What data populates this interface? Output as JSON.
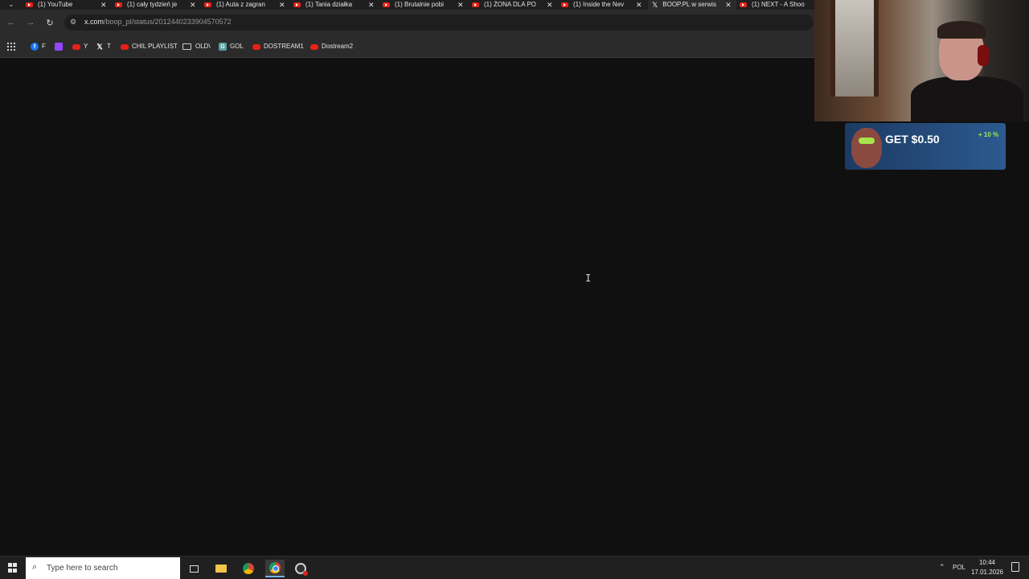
{
  "browser": {
    "tabs": [
      {
        "title": "(1) YouTube",
        "icon": "youtube-icon",
        "active": false
      },
      {
        "title": "(1) cały tydzień je",
        "icon": "youtube-icon",
        "active": false
      },
      {
        "title": "(1) Auta z zagran",
        "icon": "youtube-icon",
        "active": false
      },
      {
        "title": "(1) Tania działka",
        "icon": "youtube-icon",
        "active": false
      },
      {
        "title": "(1) Brutalnie pobi",
        "icon": "youtube-icon",
        "active": false
      },
      {
        "title": "(1) ŻONA DLA PO",
        "icon": "youtube-icon",
        "active": false
      },
      {
        "title": "(1) Inside the Nev",
        "icon": "youtube-icon",
        "active": false
      },
      {
        "title": "BOOP.PL w serwis",
        "icon": "x-icon",
        "active": true
      },
      {
        "title": "(1) NEXT - A Shoo",
        "icon": "youtube-icon",
        "active": false
      }
    ],
    "tab_close_glyph": "✕",
    "url_domain": "x.com",
    "url_path": "/boop_pl/status/2012440233904570572",
    "bookmarks": [
      {
        "label": "F",
        "icon": "facebook-icon"
      },
      {
        "label": "",
        "icon": "twitch-icon"
      },
      {
        "label": "Y",
        "icon": "youtube-icon"
      },
      {
        "label": "T",
        "icon": "x-icon"
      },
      {
        "label": "CHIL PLAYLIST",
        "icon": "youtube-icon"
      },
      {
        "label": "OLD\\",
        "icon": "folder-icon"
      },
      {
        "label": "GOL",
        "icon": "app-icon"
      },
      {
        "label": "DOSTREAM1",
        "icon": "youtube-icon"
      },
      {
        "label": "Dostream2",
        "icon": "youtube-icon"
      }
    ]
  },
  "ad": {
    "headline": "GET $0.50",
    "bonus": "+ 10 %"
  },
  "taskbar": {
    "search_placeholder": "Type here to search",
    "language": "POL",
    "time": "10:44",
    "date": "17.01.2026"
  },
  "colors": {
    "page_background": "#101010",
    "tab_strip": "#1f1f1f",
    "toolbar": "#2b2b2b",
    "taskbar": "#202020",
    "youtube_red": "#e62117"
  }
}
